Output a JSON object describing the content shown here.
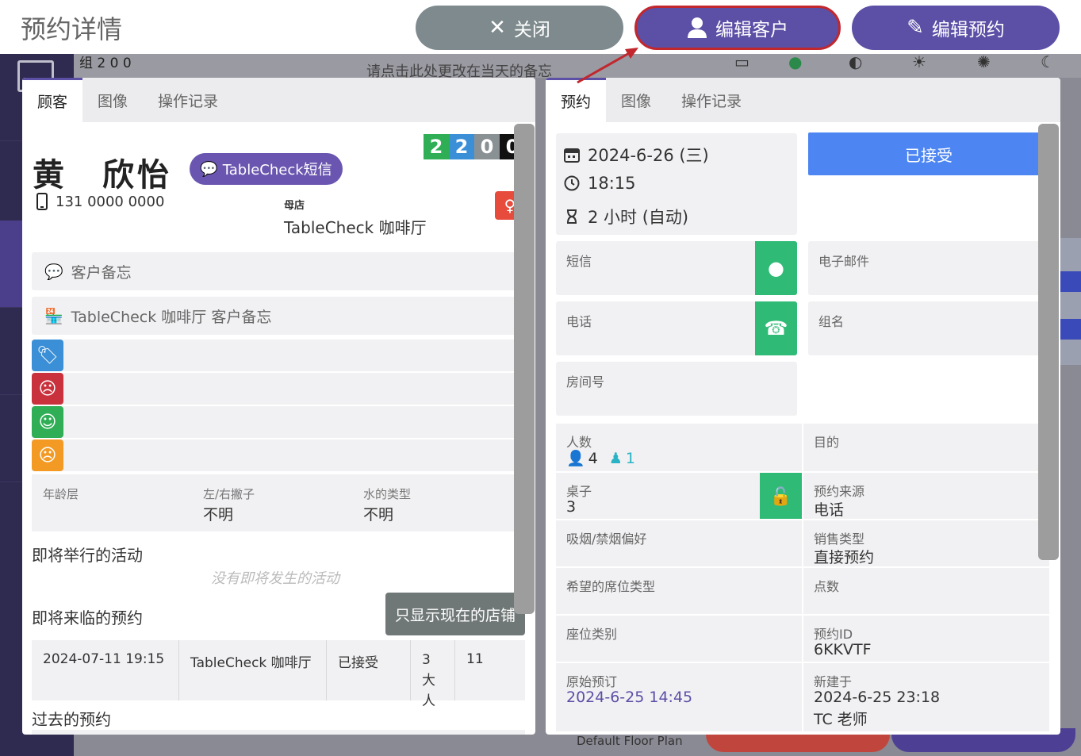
{
  "header": {
    "title": "预约详情",
    "close_label": "关闭",
    "edit_customer_label": "编辑客户",
    "edit_reservation_label": "编辑预约"
  },
  "background": {
    "counts_text": "组 2  0  0",
    "memo_hint": "请点击此处更改在当天的备忘",
    "footer_text": "Default Floor Plan"
  },
  "left_panel": {
    "tabs": [
      "顾客",
      "图像",
      "操作记录"
    ],
    "customer_name": "黄　欣怡",
    "sms_button": "TableCheck短信",
    "phone": "131 0000 0000",
    "store_label": "母店",
    "store_name": "TableCheck 咖啡厅",
    "visit_counts": [
      "2",
      "2",
      "0",
      "0"
    ],
    "customer_memo": "客户备忘",
    "store_memo": "TableCheck 咖啡厅 客户备忘",
    "attributes": [
      {
        "label": "年龄层",
        "value": ""
      },
      {
        "label": "左/右撇子",
        "value": "不明"
      },
      {
        "label": "水的类型",
        "value": "不明"
      }
    ],
    "upcoming_events_title": "即将举行的活动",
    "no_events": "没有即将发生的活动",
    "upcoming_reservations_title": "即将来临的预约",
    "only_current_store_button": "只显示现在的店铺",
    "upcoming_reservation": {
      "datetime": "2024-07-11 19:15",
      "store": "TableCheck 咖啡厅",
      "status": "已接受",
      "party": "3大人",
      "table": "11"
    },
    "past_reservations_title": "过去的预约"
  },
  "right_panel": {
    "tabs": [
      "预约",
      "图像",
      "操作记录"
    ],
    "date": "2024-6-26 (三)",
    "time": "18:15",
    "duration": "2 小时 (自动)",
    "status_button": "已接受",
    "sms_label": "短信",
    "email_label": "电子邮件",
    "phone_label": "电话",
    "group_name_label": "组名",
    "room_label": "房间号",
    "party_label": "人数",
    "party_adults": "4",
    "party_kids": "1",
    "purpose_label": "目的",
    "table_label": "桌子",
    "table_value": "3",
    "source_label": "预约来源",
    "source_value": "电话",
    "smoking_label": "吸烟/禁烟偏好",
    "sales_type_label": "销售类型",
    "sales_type_value": "直接预约",
    "seat_type_label": "希望的席位类型",
    "points_label": "点数",
    "seat_category_label": "座位类别",
    "reservation_id_label": "预约ID",
    "reservation_id_value": "6KKVTF",
    "original_booking_label": "原始预订",
    "original_booking_value": "2024-6-25 14:45",
    "created_label": "新建于",
    "created_value": "2024-6-25 23:18",
    "created_by": "TC 老师"
  },
  "colors": {
    "primary": "#5b4fa6",
    "close": "#7e8a8d",
    "accepted": "#4d86f2",
    "green": "#2fba76",
    "highlight": "#c1272d"
  }
}
